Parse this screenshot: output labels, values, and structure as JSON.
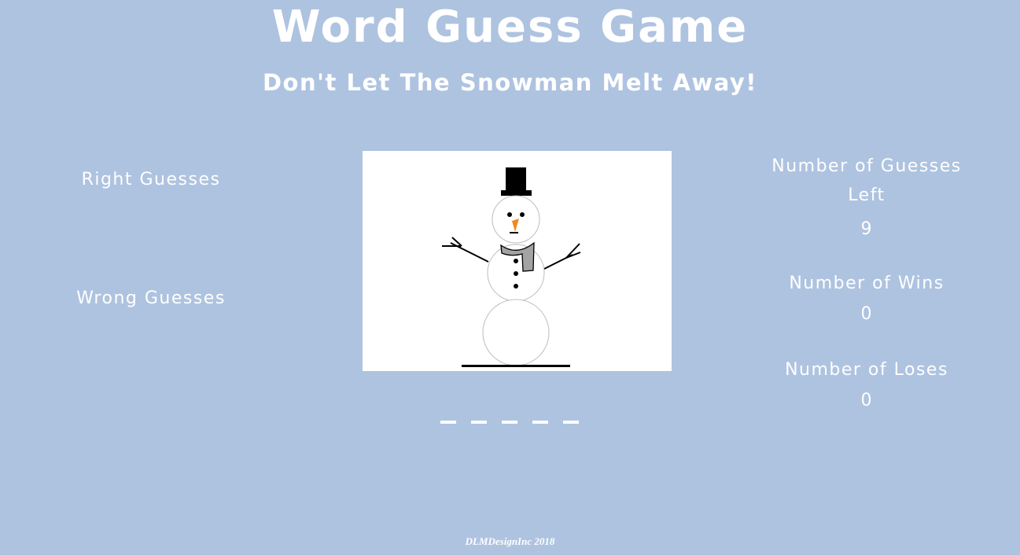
{
  "header": {
    "title": "Word Guess Game",
    "subtitle": "Don't Let The Snowman Melt Away!"
  },
  "left_panel": {
    "right_guesses_label": "Right Guesses",
    "wrong_guesses_label": "Wrong Guesses"
  },
  "right_panel": {
    "guesses_left_label": "Number of Guesses Left",
    "guesses_left_value": "9",
    "wins_label": "Number of Wins",
    "wins_value": "0",
    "loses_label": "Number of Loses",
    "loses_value": "0"
  },
  "word": {
    "blank_count": 5
  },
  "footer": {
    "text": "DLMDesignInc 2018"
  },
  "colors": {
    "background": "#aec3e0",
    "text": "#ffffff",
    "carrot": "#f08a1c",
    "scarf": "#a3a3a3"
  }
}
